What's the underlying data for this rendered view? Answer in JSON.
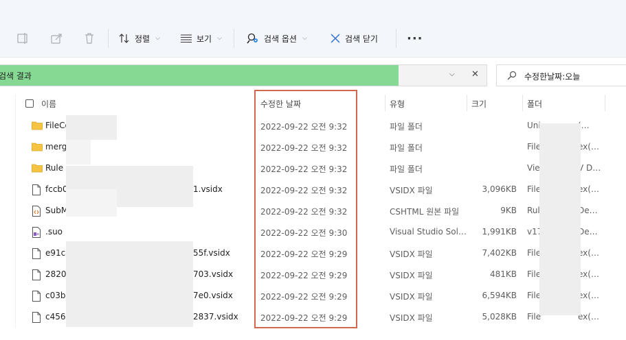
{
  "toolbar": {
    "sort_label": "정렬",
    "view_label": "보기",
    "search_options_label": "검색 옵션",
    "close_search_label": "검색 닫기",
    "more_label": "···"
  },
  "address": {
    "path_text": "검색 결과"
  },
  "search": {
    "query": "수정한날짜:오늘"
  },
  "columns": {
    "name": "이름",
    "date": "수정한 날짜",
    "type": "유형",
    "size": "크기",
    "folder": "폴더"
  },
  "rows": [
    {
      "name": "FileCo",
      "date": "2022-09-22 오전 9:32",
      "type": "파일 폴더",
      "size": "",
      "folder": "Uni",
      "folder_end": "(…",
      "icon": "folder-icon"
    },
    {
      "name": "merge",
      "date": "2022-09-22 오전 9:32",
      "type": "파일 폴더",
      "size": "",
      "folder": "File",
      "folder_end": "ex(…",
      "icon": "folder-icon"
    },
    {
      "name": "Rule",
      "date": "2022-09-22 오전 9:32",
      "type": "파일 폴더",
      "size": "",
      "folder": "Vie",
      "folder_end": "V D…",
      "icon": "folder-icon"
    },
    {
      "name": "fccb0",
      "name_end": "1.vsidx",
      "date": "2022-09-22 오전 9:32",
      "type": "VSIDX 파일",
      "size": "3,096KB",
      "folder": "File",
      "folder_end": "ex(…",
      "icon": "file-icon"
    },
    {
      "name": "SubM",
      "date": "2022-09-22 오전 9:32",
      "type": "CSHTML 원본 파일",
      "size": "9KB",
      "folder": "Rul",
      "folder_end": "De…",
      "icon": "cshtml-file-icon"
    },
    {
      "name": ".suo",
      "date": "2022-09-22 오전 9:30",
      "type": "Visual Studio Sol…",
      "size": "1,991KB",
      "folder": "v17",
      "folder_end": "De…",
      "icon": "suo-file-icon"
    },
    {
      "name": "e91c4",
      "name_end": "55f.vsidx",
      "date": "2022-09-22 오전 9:29",
      "type": "VSIDX 파일",
      "size": "7,402KB",
      "folder": "File",
      "folder_end": "ex(…",
      "icon": "file-icon"
    },
    {
      "name": "2820",
      "name_end": "703.vsidx",
      "date": "2022-09-22 오전 9:29",
      "type": "VSIDX 파일",
      "size": "481KB",
      "folder": "File",
      "folder_end": "ex(…",
      "icon": "file-icon"
    },
    {
      "name": "c03b",
      "name_end": "7e0.vsidx",
      "date": "2022-09-22 오전 9:29",
      "type": "VSIDX 파일",
      "size": "6,594KB",
      "folder": "File",
      "folder_end": "ex(…",
      "icon": "file-icon"
    },
    {
      "name": "c4562",
      "name_end": "2837.vsidx",
      "date": "2022-09-22 오전 9:29",
      "type": "VSIDX 파일",
      "size": "5,028KB",
      "folder": "File",
      "folder_end": "ex(…",
      "icon": "file-icon"
    }
  ],
  "colors": {
    "address_highlight": "#86d993",
    "column_highlight_border": "#d0674e",
    "folder_yellow": "#f6c343"
  }
}
